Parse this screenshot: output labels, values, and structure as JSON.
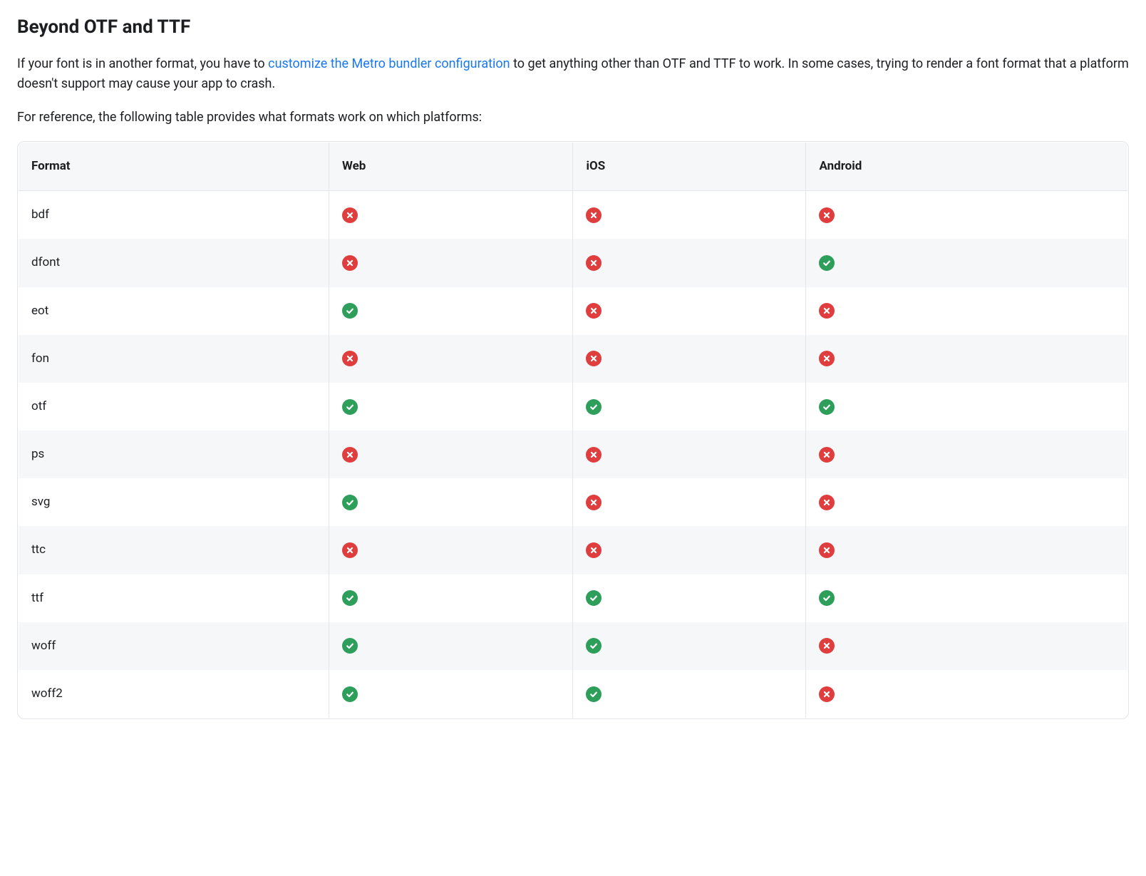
{
  "heading": "Beyond OTF and TTF",
  "paragraph1_before": "If your font is in another format, you have to ",
  "paragraph1_link": "customize the Metro bundler configuration",
  "paragraph1_after": " to get anything other than OTF and TTF to work. In some cases, trying to render a font format that a platform doesn't support may cause your app to crash.",
  "paragraph2": "For reference, the following table provides what formats work on which platforms:",
  "columns": [
    "Format",
    "Web",
    "iOS",
    "Android"
  ],
  "rows": [
    {
      "format": "bdf",
      "web": false,
      "ios": false,
      "android": false
    },
    {
      "format": "dfont",
      "web": false,
      "ios": false,
      "android": true
    },
    {
      "format": "eot",
      "web": true,
      "ios": false,
      "android": false
    },
    {
      "format": "fon",
      "web": false,
      "ios": false,
      "android": false
    },
    {
      "format": "otf",
      "web": true,
      "ios": true,
      "android": true
    },
    {
      "format": "ps",
      "web": false,
      "ios": false,
      "android": false
    },
    {
      "format": "svg",
      "web": true,
      "ios": false,
      "android": false
    },
    {
      "format": "ttc",
      "web": false,
      "ios": false,
      "android": false
    },
    {
      "format": "ttf",
      "web": true,
      "ios": true,
      "android": true
    },
    {
      "format": "woff",
      "web": true,
      "ios": true,
      "android": false
    },
    {
      "format": "woff2",
      "web": true,
      "ios": true,
      "android": false
    }
  ]
}
